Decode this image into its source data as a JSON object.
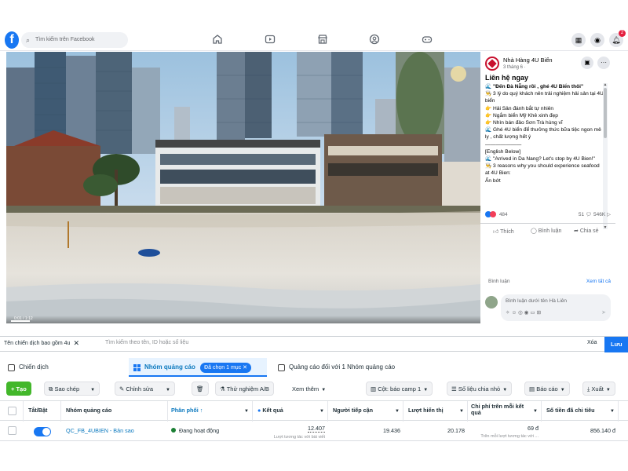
{
  "facebook": {
    "logo_letter": "f",
    "search": {
      "placeholder": "Tìm kiếm trên Facebook"
    },
    "nav_icons": [
      "home-icon",
      "watch-icon",
      "marketplace-icon",
      "groups-icon",
      "gaming-icon"
    ],
    "right_icons": [
      "menu-grid-icon",
      "messenger-icon",
      "notifications-icon"
    ],
    "notification_count": "2"
  },
  "video": {
    "time": "0:01 / 1:12",
    "progress_fraction": 0.04
  },
  "post": {
    "page_name": "Nhà Hàng 4U Biển",
    "date": "3 tháng 6 · ",
    "headline": "Liên hệ ngay",
    "lines": [
      "🌊 \"Đến Đà Nẵng rồi , ghé 4U Biển thôi\"",
      "👨‍🍳 3 lý do quý khách nên trải nghiệm hải sản tại 4U biển",
      "👉 Hải Sản đánh bắt tự nhiên",
      "👉 Ngắm biển Mỹ Khê xinh đẹp",
      "👉 Nhìn bán đảo Sơn Trà hùng vĩ",
      "🌊 Ghé 4U biển để thưởng thức bữa tiệc ngon mê ly , chất lượng hết ý",
      "———————",
      "[English Below]",
      "🌊 \"Arrived in Da Nang? Let's stop by 4U Bien!\"",
      "👨‍🍳 3 reasons why you should experience seafood at 4U Bien:"
    ],
    "collapse_label": "Ẩn bớt",
    "reaction_count": "484",
    "comment_count": "51",
    "view_count": "546K",
    "actions": {
      "like": "Thích",
      "comment": "Bình luận",
      "share": "Chia sẻ"
    },
    "comments_label": "Bình luận",
    "see_all": "Xem tất cả",
    "comment_placeholder": "Bình luận dưới tên Hà Liên"
  },
  "ads_manager": {
    "filter": {
      "chip": "Tên chiến dịch bao gồm 4u",
      "placeholder": "Tìm kiếm theo tên, ID hoặc số liệu",
      "clear": "Xóa",
      "apply": "Lưu"
    },
    "tabs": {
      "campaigns": "Chiến dịch",
      "adsets": "Nhóm quảng cáo",
      "adsets_badge": "Đã chọn 1 mục",
      "ads": "Quảng cáo đối với 1 Nhóm quảng cáo"
    },
    "toolbar": {
      "create": "Tạo",
      "duplicate": "Sao chép",
      "edit": "Chỉnh sửa",
      "ab_test": "Thử nghiệm A/B",
      "more": "Xem thêm",
      "columns": "Cột: báo camp 1",
      "breakdown": "Số liệu chia nhỏ",
      "reports": "Báo cáo",
      "export": "Xuất"
    },
    "columns": {
      "toggle": "Tắt/Bật",
      "name": "Nhóm quảng cáo",
      "delivery": "Phân phối",
      "results": "Kết quả",
      "reach": "Người tiếp cận",
      "impressions": "Lượt hiển thị",
      "cost_per_result": "Chi phí trên mỗi kết quả",
      "amount_spent": "Số tiền đã chi tiêu"
    },
    "rows": [
      {
        "name": "QC_FB_4UBIEN - Bản sao",
        "delivery": "Đang hoạt động",
        "results": "12.407",
        "results_sub": "Lượt tương tác với bài viết",
        "reach": "19.436",
        "impressions": "20.178",
        "cost_per_result": "69 đ",
        "cost_sub": "Trên mỗi lượt tương tác với ...",
        "amount_spent": "856.140 đ",
        "enabled": true
      }
    ]
  }
}
